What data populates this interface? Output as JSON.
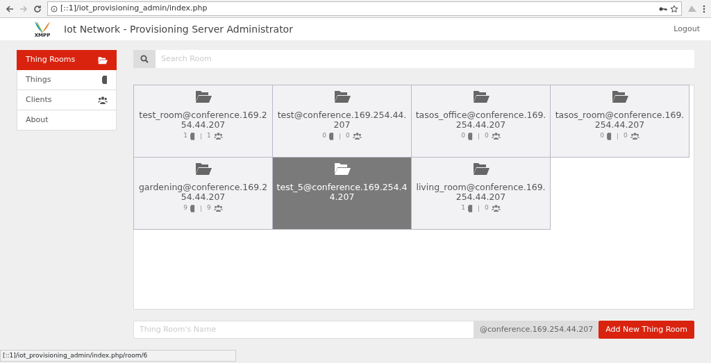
{
  "browser": {
    "url": "[::1]/iot_provisioning_admin/index.php",
    "status_url": "[::1]/iot_provisioning_admin/index.php/room/6"
  },
  "header": {
    "logo_text": "XMPP",
    "title": "Iot Network - Provisioning Server Administrator",
    "logout": "Logout"
  },
  "sidebar": {
    "items": [
      {
        "label": "Thing Rooms",
        "kind": "folder",
        "selected": true
      },
      {
        "label": "Things",
        "kind": "device",
        "selected": false
      },
      {
        "label": "Clients",
        "kind": "users",
        "selected": false
      },
      {
        "label": "About",
        "kind": "plain",
        "selected": false
      }
    ]
  },
  "search": {
    "placeholder": "Search Room"
  },
  "rooms": [
    {
      "name": "test_room@conference.169.254.44.207",
      "things": "1",
      "clients": "1",
      "selected": false
    },
    {
      "name": "test@conference.169.254.44.207",
      "things": "0",
      "clients": "0",
      "selected": false
    },
    {
      "name": "tasos_office@conference.169.254.44.207",
      "things": "0",
      "clients": "0",
      "selected": false
    },
    {
      "name": "tasos_room@conference.169.254.44.207",
      "things": "0",
      "clients": "0",
      "selected": false
    },
    {
      "name": "gardening@conference.169.254.44.207",
      "things": "9",
      "clients": "9",
      "selected": false
    },
    {
      "name": "test_5@conference.169.254.44.207",
      "selected": true
    },
    {
      "name": "living_room@conference.169.254.44.207",
      "things": "1",
      "clients": "0",
      "selected": false
    }
  ],
  "new_room": {
    "placeholder": "Thing Room's Name",
    "suffix": "@conference.169.254.44.207",
    "button": "Add New Thing Room"
  }
}
